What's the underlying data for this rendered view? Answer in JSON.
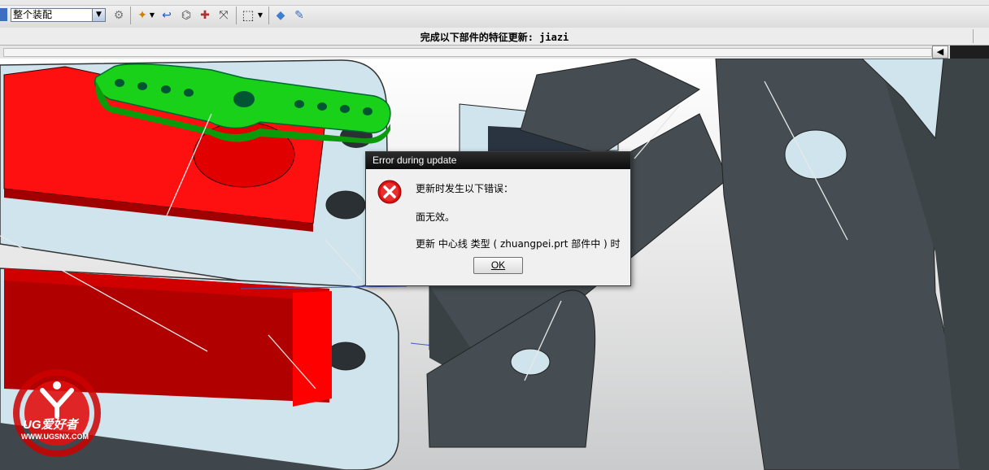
{
  "toolbar": {
    "filter_value": "整个装配",
    "icons": [
      "assembly-icon",
      "snap-icon",
      "undo-icon",
      "measure-icon",
      "transform-icon",
      "move-icon",
      "select-box-icon",
      "view-cube-icon",
      "render-icon"
    ]
  },
  "status": {
    "message": "完成以下部件的特征更新: jiazi"
  },
  "dialog": {
    "title": "Error during update",
    "line1": "更新时发生以下错误：",
    "line2": "面无效。",
    "line3": "更新 中心线 类型 ( zhuangpei.prt 部件中 ) 时",
    "ok_label": "OK"
  },
  "watermark": {
    "brand": "UG爱好者",
    "url": "WWW.UGSNX.COM"
  },
  "colors": {
    "red_part": "#e80000",
    "green_part": "#19d119",
    "plate": "#cfe4ec",
    "dark_part": "#454d52"
  }
}
